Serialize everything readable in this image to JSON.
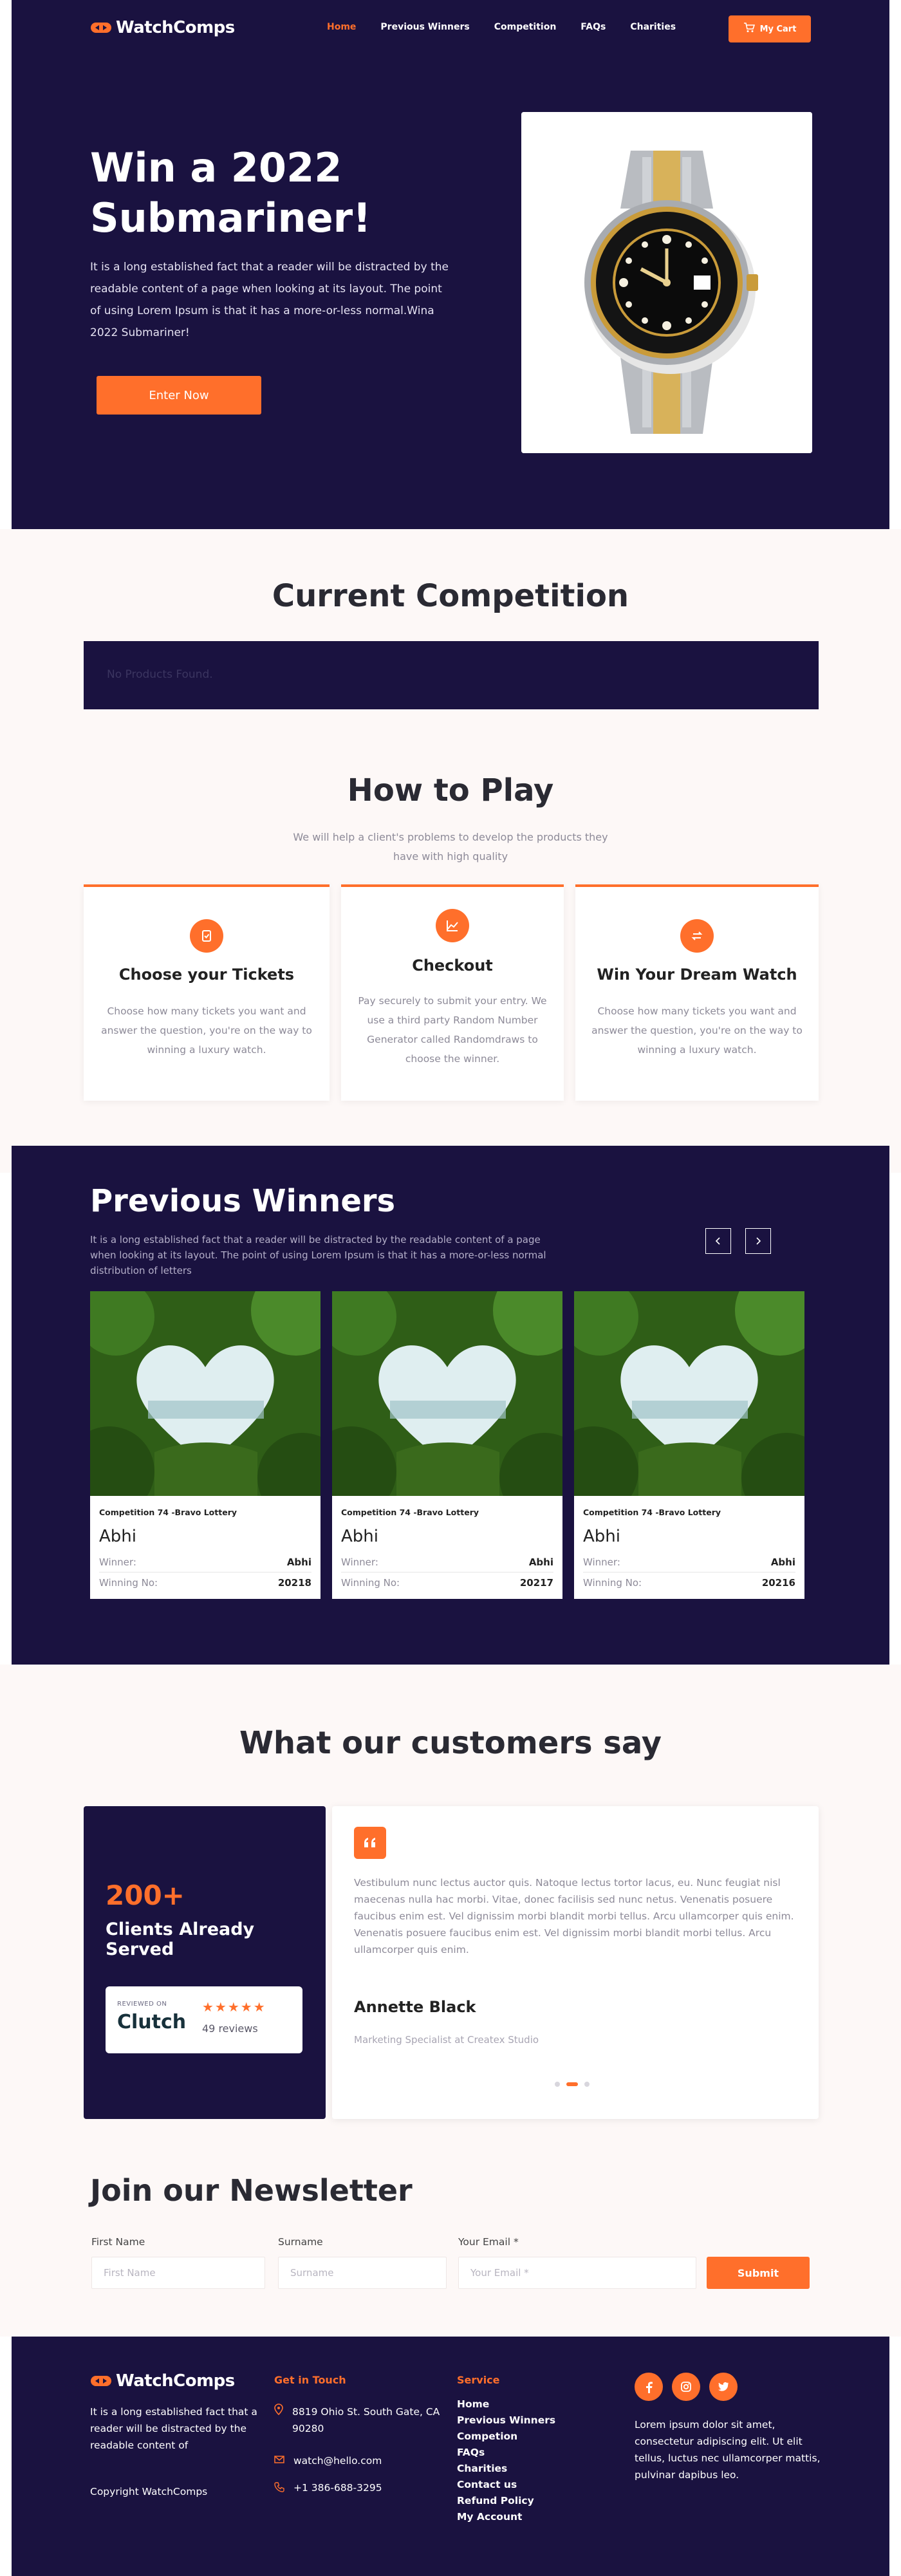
{
  "brand": {
    "name": "WatchComps",
    "accent": "#ff6f2b",
    "navy": "#1a1240"
  },
  "nav": {
    "links": [
      "Home",
      "Previous Winners",
      "Competition",
      "FAQs",
      "Charities"
    ],
    "cart_label": "My Cart"
  },
  "hero": {
    "title": "Win a 2022 Submariner!",
    "text": "It is a long established fact that a reader will be distracted by the readable content of a page when looking at its layout. The point of using Lorem Ipsum is that it has a more-or-less normal.Wina 2022 Submariner!",
    "cta": "Enter Now"
  },
  "current": {
    "title": "Current Competition",
    "empty": "No Products Found."
  },
  "how_to": {
    "title": "How to Play",
    "subtitle": "We will help a client's problems to develop the products they have with high quality",
    "cards": [
      {
        "icon": "ticket-icon",
        "title": "Choose your Tickets",
        "text": "Choose how many tickets you want and answer the question, you're on the way to winning a luxury watch."
      },
      {
        "icon": "chart-icon",
        "title": "Checkout",
        "text": "Pay securely to submit your entry. We use a third party Random Number Generator called Randomdraws to choose the winner."
      },
      {
        "icon": "exchange-icon",
        "title": "Win Your Dream Watch",
        "text": "Choose how many tickets you want and answer the question, you're on the way to winning a luxury watch."
      }
    ]
  },
  "winners": {
    "title": "Previous Winners",
    "text": "It is a long established fact that a reader will be distracted by the readable content of a page when looking at its layout. The point of using Lorem Ipsum is that it has a more-or-less normal distribution of letters",
    "cards": [
      {
        "competition": "Competition 74 -Bravo Lottery",
        "name": "Abhi",
        "winner_label": "Winner:",
        "winner": "Abhi",
        "number_label": "Winning No:",
        "number": "20218"
      },
      {
        "competition": "Competition 74 -Bravo Lottery",
        "name": "Abhi",
        "winner_label": "Winner:",
        "winner": "Abhi",
        "number_label": "Winning No:",
        "number": "20217"
      },
      {
        "competition": "Competition 74 -Bravo Lottery",
        "name": "Abhi",
        "winner_label": "Winner:",
        "winner": "Abhi",
        "number_label": "Winning No:",
        "number": "20216"
      }
    ]
  },
  "testimonials": {
    "title": "What our customers say",
    "served_count": "200+",
    "served_label": "Clients Already Served",
    "clutch": {
      "reviewed_on": "REVIEWED ON",
      "brand": "Clutch",
      "rating": 5,
      "reviews": "49 reviews"
    },
    "quote": "Vestibulum nunc lectus auctor quis. Natoque lectus tortor lacus, eu. Nunc feugiat nisl maecenas nulla hac morbi. Vitae, donec facilisis sed nunc netus. Venenatis posuere faucibus enim est. Vel dignissim morbi blandit morbi tellus. Arcu ullamcorper quis enim. Venenatis posuere faucibus enim est. Vel dignissim morbi blandit morbi tellus. Arcu ullamcorper quis enim.",
    "name": "Annette Black",
    "role": "Marketing Specialist at Createx Studio"
  },
  "newsletter": {
    "title": "Join our Newsletter",
    "first_label": "First Name",
    "first_placeholder": "First Name",
    "last_label": "Surname",
    "last_placeholder": "Surname",
    "email_label": "Your Email *",
    "email_placeholder": "Your Email *",
    "submit": "Submit"
  },
  "footer": {
    "about": "It is a long established fact that a reader will be distracted by the readable content of",
    "copyright": "Copyright WatchComps",
    "contact_title": "Get in Touch",
    "address": "8819 Ohio St. South Gate, CA 90280",
    "email": "watch@hello.com",
    "phone": "+1 386-688-3295",
    "service_title": "Service",
    "service_links": [
      "Home",
      "Previous Winners",
      "Competion",
      "FAQs",
      "Charities",
      "Contact us",
      "Refund Policy",
      "My Account"
    ],
    "social_text": "Lorem ipsum dolor sit amet, consectetur adipiscing elit. Ut elit tellus, luctus nec ullamcorper mattis, pulvinar dapibus leo."
  }
}
